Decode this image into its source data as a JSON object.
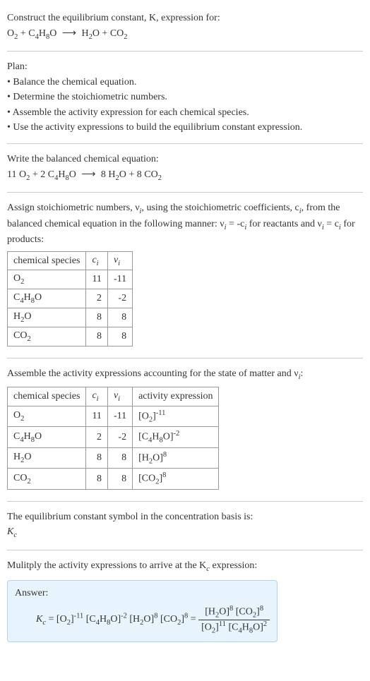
{
  "intro": {
    "prompt": "Construct the equilibrium constant, K, expression for:",
    "equation_lhs_1": "O",
    "equation_lhs_1_sub": "2",
    "equation_plus_1": " + C",
    "equation_lhs_2_sub1": "4",
    "equation_lhs_2_mid": "H",
    "equation_lhs_2_sub2": "8",
    "equation_lhs_2_end": "O",
    "arrow": "⟶",
    "equation_rhs_1": "H",
    "equation_rhs_1_sub": "2",
    "equation_rhs_1_end": "O + CO",
    "equation_rhs_2_sub": "2"
  },
  "plan": {
    "title": "Plan:",
    "items": [
      "• Balance the chemical equation.",
      "• Determine the stoichiometric numbers.",
      "• Assemble the activity expression for each chemical species.",
      "• Use the activity expressions to build the equilibrium constant expression."
    ]
  },
  "balanced": {
    "title": "Write the balanced chemical equation:",
    "coef1": "11 O",
    "sub1": "2",
    "plus1": " + 2 C",
    "sub2": "4",
    "mid2": "H",
    "sub3": "8",
    "end2": "O",
    "arrow": "⟶",
    "coef3": "8 H",
    "sub4": "2",
    "end3": "O + 8 CO",
    "sub5": "2"
  },
  "stoich": {
    "intro_1": "Assign stoichiometric numbers, ν",
    "intro_1_sub": "i",
    "intro_2": ", using the stoichiometric coefficients, c",
    "intro_2_sub": "i",
    "intro_3": ", from the balanced chemical equation in the following manner: ν",
    "intro_3_sub": "i",
    "intro_4": " = -c",
    "intro_4_sub": "i",
    "intro_5": " for reactants and ν",
    "intro_5_sub": "i",
    "intro_6": " = c",
    "intro_6_sub": "i",
    "intro_7": " for products:",
    "headers": {
      "species": "chemical species",
      "c": "c",
      "c_sub": "i",
      "v": "ν",
      "v_sub": "i"
    },
    "rows": [
      {
        "species_pre": "O",
        "species_sub": "2",
        "species_post": "",
        "c": "11",
        "v": "-11"
      },
      {
        "species_pre": "C",
        "species_sub": "4",
        "species_mid": "H",
        "species_sub2": "8",
        "species_post": "O",
        "c": "2",
        "v": "-2"
      },
      {
        "species_pre": "H",
        "species_sub": "2",
        "species_post": "O",
        "c": "8",
        "v": "8"
      },
      {
        "species_pre": "CO",
        "species_sub": "2",
        "species_post": "",
        "c": "8",
        "v": "8"
      }
    ]
  },
  "activity": {
    "intro_1": "Assemble the activity expressions accounting for the state of matter and ν",
    "intro_1_sub": "i",
    "intro_2": ":",
    "headers": {
      "species": "chemical species",
      "c": "c",
      "c_sub": "i",
      "v": "ν",
      "v_sub": "i",
      "activity": "activity expression"
    },
    "rows": [
      {
        "sp_pre": "O",
        "sp_sub": "2",
        "sp_post": "",
        "c": "11",
        "v": "-11",
        "act_pre": "[O",
        "act_sub": "2",
        "act_post": "]",
        "act_sup": "-11"
      },
      {
        "sp_pre": "C",
        "sp_sub": "4",
        "sp_mid": "H",
        "sp_sub2": "8",
        "sp_post": "O",
        "c": "2",
        "v": "-2",
        "act_pre": "[C",
        "act_sub": "4",
        "act_mid": "H",
        "act_sub2": "8",
        "act_post": "O]",
        "act_sup": "-2"
      },
      {
        "sp_pre": "H",
        "sp_sub": "2",
        "sp_post": "O",
        "c": "8",
        "v": "8",
        "act_pre": "[H",
        "act_sub": "2",
        "act_post": "O]",
        "act_sup": "8"
      },
      {
        "sp_pre": "CO",
        "sp_sub": "2",
        "sp_post": "",
        "c": "8",
        "v": "8",
        "act_pre": "[CO",
        "act_sub": "2",
        "act_post": "]",
        "act_sup": "8"
      }
    ]
  },
  "symbol": {
    "text": "The equilibrium constant symbol in the concentration basis is:",
    "k": "K",
    "k_sub": "c"
  },
  "final": {
    "intro_1": "Mulitply the activity expressions to arrive at the K",
    "intro_1_sub": "c",
    "intro_2": " expression:",
    "answer_label": "Answer:",
    "k": "K",
    "k_sub": "c",
    "eq": " = [O",
    "sub1": "2",
    "p1": "]",
    "sup1": "-11",
    "p2": " [C",
    "sub2": "4",
    "p3": "H",
    "sub3": "8",
    "p4": "O]",
    "sup2": "-2",
    "p5": " [H",
    "sub4": "2",
    "p6": "O]",
    "sup3": "8",
    "p7": " [CO",
    "sub5": "2",
    "p8": "]",
    "sup4": "8",
    "eq2": " = ",
    "frac_top_1": "[H",
    "frac_top_sub1": "2",
    "frac_top_2": "O]",
    "frac_top_sup1": "8",
    "frac_top_3": " [CO",
    "frac_top_sub2": "2",
    "frac_top_4": "]",
    "frac_top_sup2": "8",
    "frac_bot_1": "[O",
    "frac_bot_sub1": "2",
    "frac_bot_2": "]",
    "frac_bot_sup1": "11",
    "frac_bot_3": " [C",
    "frac_bot_sub2": "4",
    "frac_bot_4": "H",
    "frac_bot_sub3": "8",
    "frac_bot_5": "O]",
    "frac_bot_sup2": "2"
  }
}
